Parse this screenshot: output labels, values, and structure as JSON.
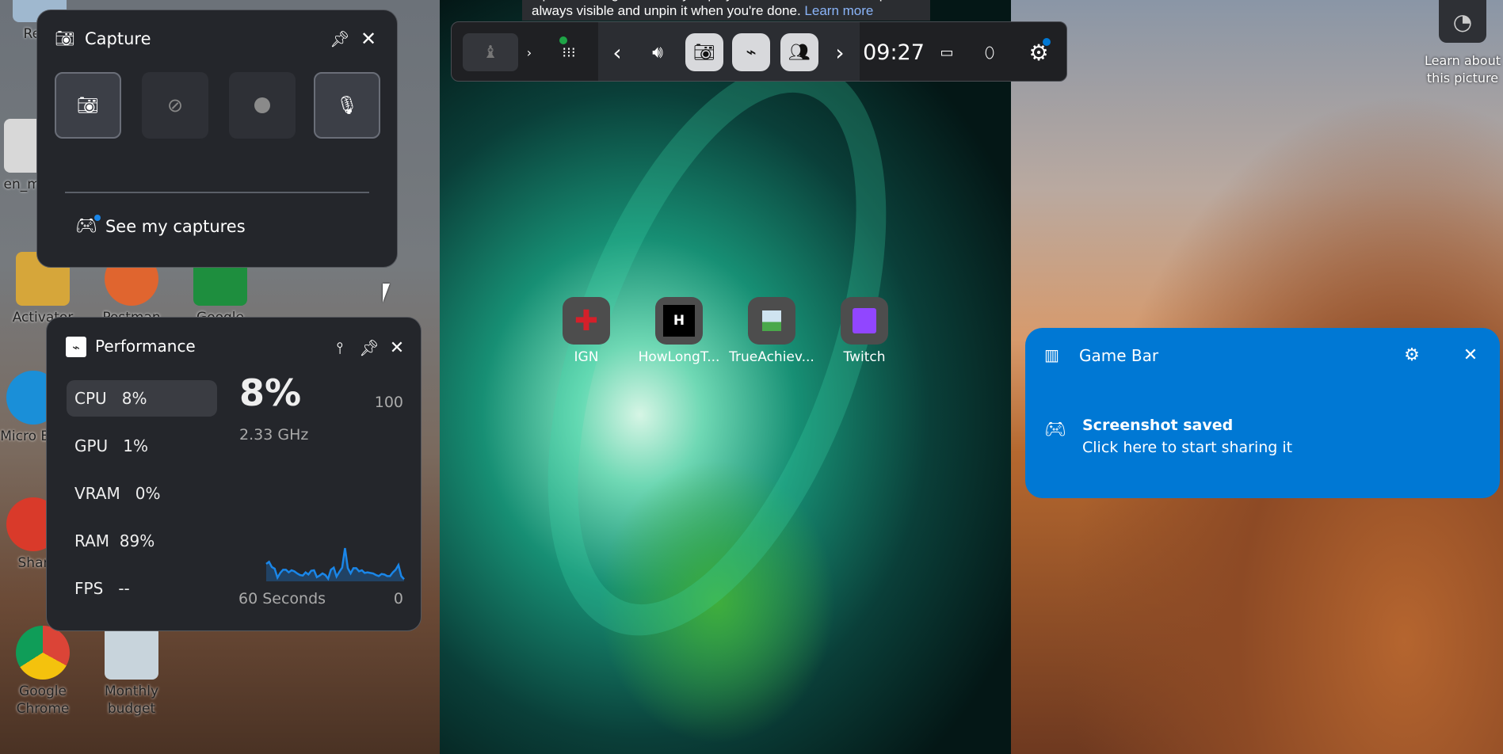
{
  "desktop": {
    "icons": [
      {
        "label": "Recy",
        "color": "#9fb8cf"
      },
      {
        "label": "en_mi",
        "color": "#d8d8d8"
      },
      {
        "label": "Activator",
        "color": "#d6a63a"
      },
      {
        "label": "Postman",
        "color": "#e0652f"
      },
      {
        "label": "Google",
        "color": "#1e8e3e"
      },
      {
        "label": "Micro Edg",
        "color": "#1a8fd8"
      },
      {
        "label": "Shar",
        "color": "#d93a2a"
      },
      {
        "label": "Google Chrome",
        "color": "#e5b41c"
      },
      {
        "label": "Monthly budget",
        "color": "#5a9a5a"
      }
    ],
    "learn_about": "Learn about this picture"
  },
  "tip": {
    "text": "Tip: Follow a guide while you play! Pin Game Assist to keep it always visible and unpin it when you're done.",
    "link": "Learn more"
  },
  "toolbar": {
    "time": "09:27",
    "accent": "#0078d4",
    "status_dot": "#1ea446"
  },
  "capture": {
    "title": "Capture",
    "see_captures": "See my captures"
  },
  "performance": {
    "title": "Performance",
    "rows": [
      {
        "label": "CPU",
        "value": "8%"
      },
      {
        "label": "GPU",
        "value": "1%"
      },
      {
        "label": "VRAM",
        "value": "0%"
      },
      {
        "label": "RAM",
        "value": "89%"
      },
      {
        "label": "FPS",
        "value": "--"
      }
    ],
    "big_value": "8%",
    "freq": "2.33 GHz",
    "max_label": "100",
    "time_label": "60 Seconds",
    "min_label": "0",
    "graph": {
      "type": "area",
      "ylim": [
        0,
        100
      ],
      "color": "#1a86e8",
      "values": [
        33,
        37,
        27,
        24,
        7,
        16,
        22,
        22,
        17,
        21,
        19,
        15,
        12,
        11,
        17,
        13,
        20,
        21,
        8,
        11,
        15,
        12,
        5,
        22,
        26,
        9,
        18,
        26,
        63,
        25,
        15,
        25,
        25,
        19,
        21,
        16,
        17,
        16,
        15,
        12,
        10,
        14,
        13,
        10,
        10,
        17,
        22,
        31,
        10,
        4
      ]
    }
  },
  "apps": [
    {
      "label": "IGN"
    },
    {
      "label": "HowLongT..."
    },
    {
      "label": "TrueAchiev..."
    },
    {
      "label": "Twitch"
    }
  ],
  "notification": {
    "app": "Game Bar",
    "title": "Screenshot saved",
    "body": "Click here to start sharing it",
    "bg": "#0078d4"
  }
}
